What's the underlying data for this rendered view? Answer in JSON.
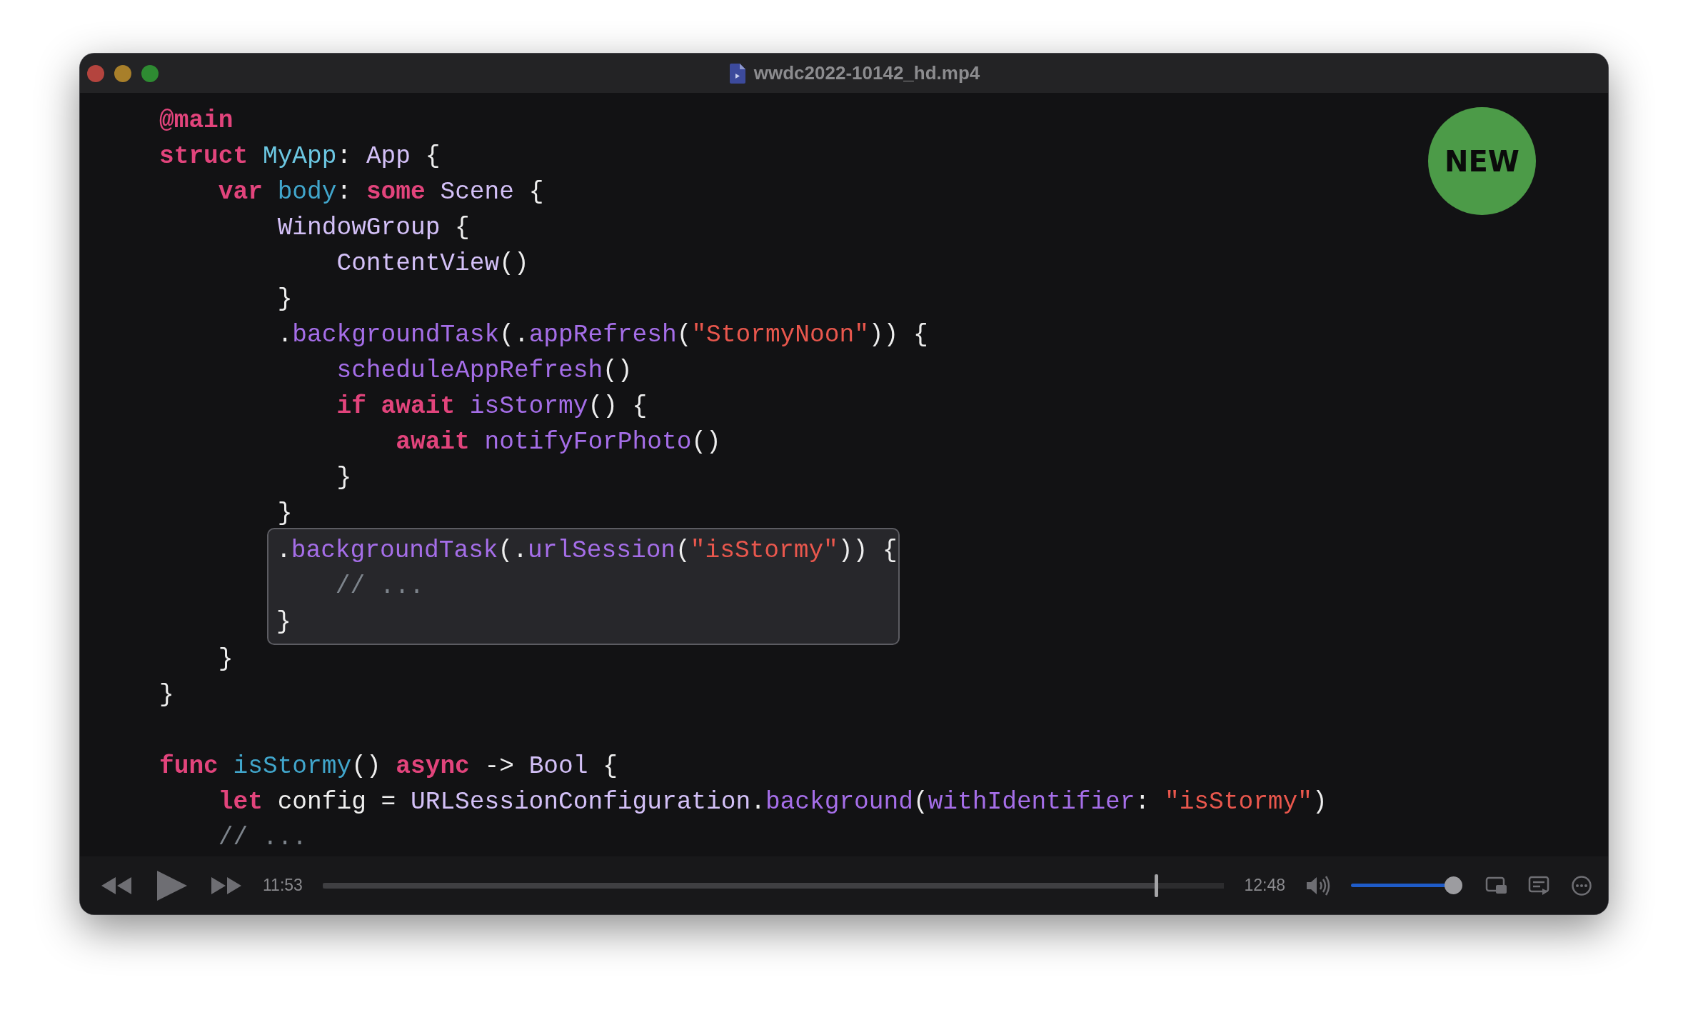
{
  "window": {
    "title": "wwdc2022-10142_hd.mp4"
  },
  "badge": {
    "text": "NEW"
  },
  "code_blocks": [
    {
      "kind": "plain",
      "lines": [
        {
          "kind": "code",
          "tokens": [
            {
              "kind": "kw",
              "text": "@main"
            }
          ]
        },
        {
          "kind": "code",
          "tokens": [
            {
              "kind": "kw",
              "text": "struct"
            },
            {
              "kind": "decl",
              "text": " MyApp"
            },
            {
              "kind": "plain",
              "text": ": "
            },
            {
              "kind": "type",
              "text": "App"
            },
            {
              "kind": "plain",
              "text": " {"
            }
          ]
        },
        {
          "kind": "code",
          "tokens": [
            {
              "kind": "kw",
              "text": "    var"
            },
            {
              "kind": "decl2",
              "text": " body"
            },
            {
              "kind": "plain",
              "text": ": "
            },
            {
              "kind": "kw",
              "text": "some"
            },
            {
              "kind": "type",
              "text": " Scene"
            },
            {
              "kind": "plain",
              "text": " {"
            }
          ]
        },
        {
          "kind": "code",
          "tokens": [
            {
              "kind": "type",
              "text": "        WindowGroup"
            },
            {
              "kind": "plain",
              "text": " {"
            }
          ]
        },
        {
          "kind": "code",
          "tokens": [
            {
              "kind": "type",
              "text": "            ContentView"
            },
            {
              "kind": "plain",
              "text": "()"
            }
          ]
        },
        {
          "kind": "code",
          "tokens": [
            {
              "kind": "plain",
              "text": "        }"
            }
          ]
        },
        {
          "kind": "code",
          "tokens": [
            {
              "kind": "plain",
              "text": "        ."
            },
            {
              "kind": "call",
              "text": "backgroundTask"
            },
            {
              "kind": "plain",
              "text": "(."
            },
            {
              "kind": "call",
              "text": "appRefresh"
            },
            {
              "kind": "plain",
              "text": "("
            },
            {
              "kind": "str",
              "text": "\"StormyNoon\""
            },
            {
              "kind": "plain",
              "text": ")) {"
            }
          ]
        },
        {
          "kind": "code",
          "tokens": [
            {
              "kind": "call",
              "text": "            scheduleAppRefresh"
            },
            {
              "kind": "plain",
              "text": "()"
            }
          ]
        },
        {
          "kind": "code",
          "tokens": [
            {
              "kind": "kw",
              "text": "            if"
            },
            {
              "kind": "kw",
              "text": " await"
            },
            {
              "kind": "call",
              "text": " isStormy"
            },
            {
              "kind": "plain",
              "text": "() {"
            }
          ]
        },
        {
          "kind": "code",
          "tokens": [
            {
              "kind": "kw",
              "text": "                await"
            },
            {
              "kind": "call",
              "text": " notifyForPhoto"
            },
            {
              "kind": "plain",
              "text": "()"
            }
          ]
        },
        {
          "kind": "code",
          "tokens": [
            {
              "kind": "plain",
              "text": "            }"
            }
          ]
        },
        {
          "kind": "code",
          "tokens": [
            {
              "kind": "plain",
              "text": "        }"
            }
          ]
        }
      ]
    },
    {
      "kind": "highlight",
      "lines": [
        {
          "kind": "code",
          "tokens": [
            {
              "kind": "plain",
              "text": "."
            },
            {
              "kind": "call",
              "text": "backgroundTask"
            },
            {
              "kind": "plain",
              "text": "(."
            },
            {
              "kind": "call",
              "text": "urlSession"
            },
            {
              "kind": "plain",
              "text": "("
            },
            {
              "kind": "str",
              "text": "\"isStormy\""
            },
            {
              "kind": "plain",
              "text": ")) {"
            }
          ]
        },
        {
          "kind": "code",
          "tokens": [
            {
              "kind": "cmt",
              "text": "    // ..."
            }
          ]
        },
        {
          "kind": "code",
          "tokens": [
            {
              "kind": "plain",
              "text": "}"
            }
          ]
        }
      ]
    },
    {
      "kind": "plain",
      "lines": [
        {
          "kind": "code",
          "tokens": [
            {
              "kind": "plain",
              "text": "    }"
            }
          ]
        },
        {
          "kind": "code",
          "tokens": [
            {
              "kind": "plain",
              "text": "}"
            }
          ]
        },
        {
          "kind": "blank"
        },
        {
          "kind": "code",
          "tokens": [
            {
              "kind": "kw",
              "text": "func"
            },
            {
              "kind": "decl2",
              "text": " isStormy"
            },
            {
              "kind": "plain",
              "text": "() "
            },
            {
              "kind": "kw",
              "text": "async"
            },
            {
              "kind": "plain",
              "text": " -> "
            },
            {
              "kind": "type",
              "text": "Bool"
            },
            {
              "kind": "plain",
              "text": " {"
            }
          ]
        },
        {
          "kind": "code",
          "tokens": [
            {
              "kind": "kw",
              "text": "    let"
            },
            {
              "kind": "plain",
              "text": " config = "
            },
            {
              "kind": "type",
              "text": "URLSessionConfiguration"
            },
            {
              "kind": "plain",
              "text": "."
            },
            {
              "kind": "call",
              "text": "background"
            },
            {
              "kind": "plain",
              "text": "("
            },
            {
              "kind": "call",
              "text": "withIdentifier"
            },
            {
              "kind": "plain",
              "text": ": "
            },
            {
              "kind": "str",
              "text": "\"isStormy\""
            },
            {
              "kind": "plain",
              "text": ")"
            }
          ]
        },
        {
          "kind": "code",
          "tokens": [
            {
              "kind": "cmt",
              "text": "    // ..."
            }
          ]
        }
      ]
    }
  ],
  "player": {
    "elapsed": "11:53",
    "progress": {
      "level": 0.925
    },
    "remaining": "12:48",
    "volume": {
      "level": 0.94
    }
  }
}
